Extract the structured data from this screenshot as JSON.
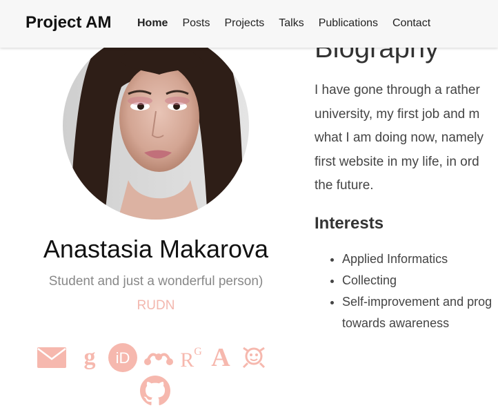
{
  "navbar": {
    "brand": "Project AM",
    "links": [
      "Home",
      "Posts",
      "Projects",
      "Talks",
      "Publications",
      "Contact"
    ],
    "active": "Home"
  },
  "profile": {
    "name": "Anastasia Makarova",
    "role": "Student and just a wonderful person)",
    "organization": "RUDN",
    "social_icons": [
      "envelope-icon",
      "google-scholar-icon",
      "orcid-icon",
      "mendeley-icon",
      "researchgate-icon",
      "academia-icon",
      "kaggle-icon",
      "github-icon"
    ],
    "orcid_text": "iD",
    "researchgate_text": "R",
    "researchgate_sup": "G",
    "academia_text": "A",
    "google_scholar_text": "g"
  },
  "biography": {
    "title": "Biography",
    "lines": [
      "I have gone through a rather",
      "university, my first job and m",
      "what I am doing now, namely",
      "first website in my life, in ord",
      "the future."
    ]
  },
  "interests": {
    "title": "Interests",
    "items": [
      "Applied Informatics",
      "Collecting",
      "Self-improvement and prog"
    ],
    "continuation": "towards awareness"
  },
  "colors": {
    "accent": "#f6b8ae",
    "navbar_bg": "#f7f7f7",
    "muted": "#888888"
  }
}
